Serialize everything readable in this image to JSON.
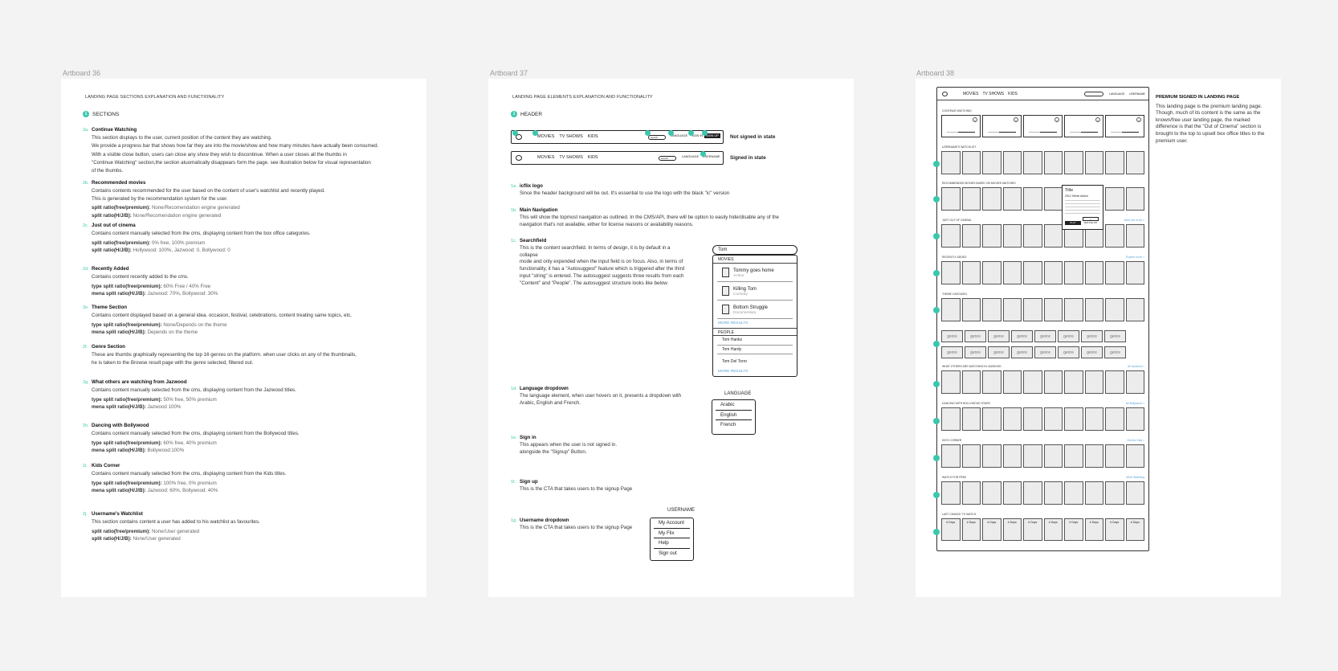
{
  "artboards": [
    {
      "label": "Artboard 36"
    },
    {
      "label": "Artboard 37"
    },
    {
      "label": "Artboard 38"
    }
  ],
  "ab36": {
    "header": "LANDING PAGE SECTIONS EXPLANATION AND FUNCTIONALITY",
    "section_num": "1",
    "section_title": "SECTIONS",
    "items": [
      {
        "id": "2a.",
        "title": "Continue Watching",
        "lines": [
          "This section displays to the user, current position of the content they are watching.",
          "We provide a progress bar that shows how far they are into the movie/show and how many minutes have actually been consumed.",
          "With a visible close button, users can close any show they wish to discontinue. When a user closes all the thumbs in",
          "\"Continue Watching\" section,the section atuomatically disappears form the page.  see illustration below for visual representation",
          "of the thumbs."
        ],
        "kv": []
      },
      {
        "id": "2b.",
        "title": "Recommended movies",
        "lines": [
          "Contains contents recommended for the user based on the content of user's watchlist and recently played.",
          "This is generated by the recommendation system for the user."
        ],
        "kv": [
          {
            "k": "split ratio(free/premium):",
            "v": "None/Recomendation engine generated"
          },
          {
            "k": "split ratio(H/J/B):",
            "v": "None/Recomendation engine generated"
          }
        ]
      },
      {
        "id": "2c.",
        "title": "Just out of cinema",
        "lines": [
          "Contains content manually selected from the cms, displaying content from the box office categories."
        ],
        "kv": [
          {
            "k": "split ratio(free/premium):",
            "v": "0% free, 100% premium"
          },
          {
            "k": "split ratio(H/J/B):",
            "v": "Hollywood: 100%, Jazwood: 0, Bollywood: 0"
          }
        ]
      },
      {
        "id": "2d.",
        "title": "Recently Added",
        "lines": [
          "Contains content recently added to the cms."
        ],
        "kv": [
          {
            "k": "type split ratio(free/premium):",
            "v": "60% Free / 40% Free"
          },
          {
            "k": "mena split ratio(H/J/B):",
            "v": "Jazwood: 70%, Bollywood: 30%"
          }
        ]
      },
      {
        "id": "2e.",
        "title": "Theme Section",
        "lines": [
          "Contains content displayed based on a general idea. occasion, festival, celebrations, content treating same topics, etc."
        ],
        "kv": [
          {
            "k": "type split ratio(free/premium):",
            "v": "None/Depends on the theme"
          },
          {
            "k": "mena split ratio(H/J/B):",
            "v": "Depends on the theme"
          }
        ]
      },
      {
        "id": "2f.",
        "title": "Genre Section",
        "lines": [
          "These are thumbs graphically representing the top 16 genres on the platform. when user clicks on any of the thumbnails,",
          "he is taken to the Browse result page with the genre selected, filtered out."
        ],
        "kv": []
      },
      {
        "id": "2g.",
        "title": "What others are watching from Jazwood",
        "lines": [
          "Contains content manually selected from the cms, displaying content from the Jazwood titles."
        ],
        "kv": [
          {
            "k": "type split ratio(free/premium):",
            "v": "50% free, 50% premium"
          },
          {
            "k": "mena split ratio(H/J/B):",
            "v": "Jazwood 100%"
          }
        ]
      },
      {
        "id": "2h.",
        "title": "Dancing with Bollywood",
        "lines": [
          "Contains content manually selected from the cms, displaying content from the Bollywood titles."
        ],
        "kv": [
          {
            "k": "type split ratio(free/premium):",
            "v": "60% free, 40% premium"
          },
          {
            "k": "mena split ratio(H/J/B):",
            "v": "Bollywood:100%"
          }
        ]
      },
      {
        "id": "2i.",
        "title": "Kids Corner",
        "lines": [
          "Contains content manually selected from the cms, displaying content from the Kids titles."
        ],
        "kv": [
          {
            "k": "type split ratio(free/premium):",
            "v": "100% free, 0% premium"
          },
          {
            "k": "mena split ratio(H/J/B):",
            "v": "Jazwood: 60%, Bollywood: 40%"
          }
        ]
      },
      {
        "id": "2j.",
        "title": "Username's Watchlist",
        "lines": [
          "This section contains content a user has added to his watchlist as favourites."
        ],
        "kv": [
          {
            "k": "split ratio(free/premium):",
            "v": "None/User generated"
          },
          {
            "k": "split ratio(H/J/B):",
            "v": "None/User generated"
          }
        ]
      }
    ]
  },
  "ab37": {
    "header": "LANDING PAGE ELEMENTS EXPLANATION AND FUNCTIONALITY",
    "section_num": "1",
    "section_title": "HEADER",
    "nav_links": [
      "MOVIES",
      "TV SHOWS",
      "KIDS"
    ],
    "nav_search": "search",
    "nav_language": "LANGUAGE",
    "nav_signin": "SIGN IN",
    "nav_signup": "SIGN UP",
    "nav_username": "USERNAME",
    "state_out": "Not signed in state",
    "state_in": "Signed in state",
    "items": [
      {
        "id": "1a.",
        "title": "icflix logo",
        "lines": [
          "Since the header background will be out. It's essential to use the logo with the black \"ic\" version"
        ]
      },
      {
        "id": "1b.",
        "title": "Main Navigation",
        "lines": [
          "This will show the topmost navigation as outlined. In the CMS/API, there will be option to easily hide/disable any of the",
          "navigation that's not available, either for license reasons or availability reasons."
        ]
      },
      {
        "id": "1c.",
        "title": "Searchfield",
        "lines": [
          "This is the content searchfield. In terms of design, it is by default in a collapse",
          "mode and only expended when the input field is on focus.  Also, in terms of",
          "functionality, it has a \"Autosuggest\" feature which is triggered after the third",
          " input \"string\" is entered. The autosuggest suggests three results from each",
          "\"Content\" and \"People\". The autosuggest structure looks like below."
        ]
      },
      {
        "id": "1d.",
        "title": "Language dropdown",
        "lines": [
          "The language element, when user hovers on it, presents a dropdown with",
          "Arabic, English and French."
        ]
      },
      {
        "id": "1e.",
        "title": "Sign in",
        "lines": [
          "This appears when the user is not signed in.",
          "alongside the \"Signup\" Button."
        ]
      },
      {
        "id": "1f.",
        "title": "Sign up",
        "lines": [
          "This is the CTA that takes users to the signup Page"
        ]
      },
      {
        "id": "1g.",
        "title": "Username dropdown",
        "lines": [
          "This is the CTA that takes users to the signup Page"
        ]
      }
    ],
    "search_value": "Tom",
    "suggest_movies_label": "MOVIES",
    "suggest_movies": [
      {
        "name": "Tommy goes home",
        "genre": "Action"
      },
      {
        "name": "Killing Tom",
        "genre": "Comedy"
      },
      {
        "name": "Bottom Struggle",
        "genre": "Documentary"
      }
    ],
    "more_results": "MORE RESULTS",
    "suggest_people_label": "PEOPLE",
    "suggest_people": [
      "Tom Hanks",
      "Tom Hardy",
      "Tom Del Torro"
    ],
    "language_title": "LANGUAGE",
    "language_options": [
      "Arabic",
      "English",
      "French"
    ],
    "username_title": "USERNAME",
    "username_options": [
      "My Account",
      "My Flix",
      "Help",
      "Sign out"
    ]
  },
  "ab38": {
    "nav_links": [
      "MOVIES",
      "TV SHOWS",
      "KIDS"
    ],
    "nav_language": "LANGUAGE",
    "nav_username": "USERNAME",
    "rows": [
      {
        "title": "CONTINUE WATCHING",
        "more": ""
      },
      {
        "title": "USERNAME'S WATCHLIST",
        "more": ""
      },
      {
        "title": "RECOMMENDED MOVIES BASED ON MOVIES WATCHED",
        "more": ""
      },
      {
        "title": "JUST OUT OF CINEMA",
        "more": "More out of cin >"
      },
      {
        "title": "RECENTLY ADDED",
        "more": "Explore more >"
      },
      {
        "title": "THEME CAROUSEL",
        "more": ""
      },
      {
        "title": "WHAT OTHERS ARE WATCHING IN JAZWOOD",
        "more": "All Jazwood >"
      },
      {
        "title": "DANCING WITH BOLLYWOOD STARS",
        "more": "All Bollywood >"
      },
      {
        "title": "KID'S CORNER",
        "more": "Visit for Kids >"
      },
      {
        "title": "WATCH FOR FREE",
        "more": "More Watching"
      },
      {
        "title": "LAST CHANCE TO WATCH",
        "more": ""
      }
    ],
    "genre_label": "genre",
    "last_chance_label": "# Days",
    "hover_title": "Title",
    "hover_meta": "2012    90min    Action",
    "hover_play": "PLAY",
    "hover_watch": "+ WATCHLIST",
    "side_title": "PREMIUM SIGNED IN LANDING PAGE",
    "side_text": "This landing page is the premium landing page. Though, much of its content is the same as the known/free user landing page, the marked difference is that the \"Out of Cinema\" section is brought to the top to upsell box office titles to the premium user.",
    "markers": [
      "2j",
      "2b",
      "2c",
      "2d",
      "2e",
      "2f",
      "2g",
      "2h",
      "2i",
      "2k",
      "2l"
    ]
  }
}
